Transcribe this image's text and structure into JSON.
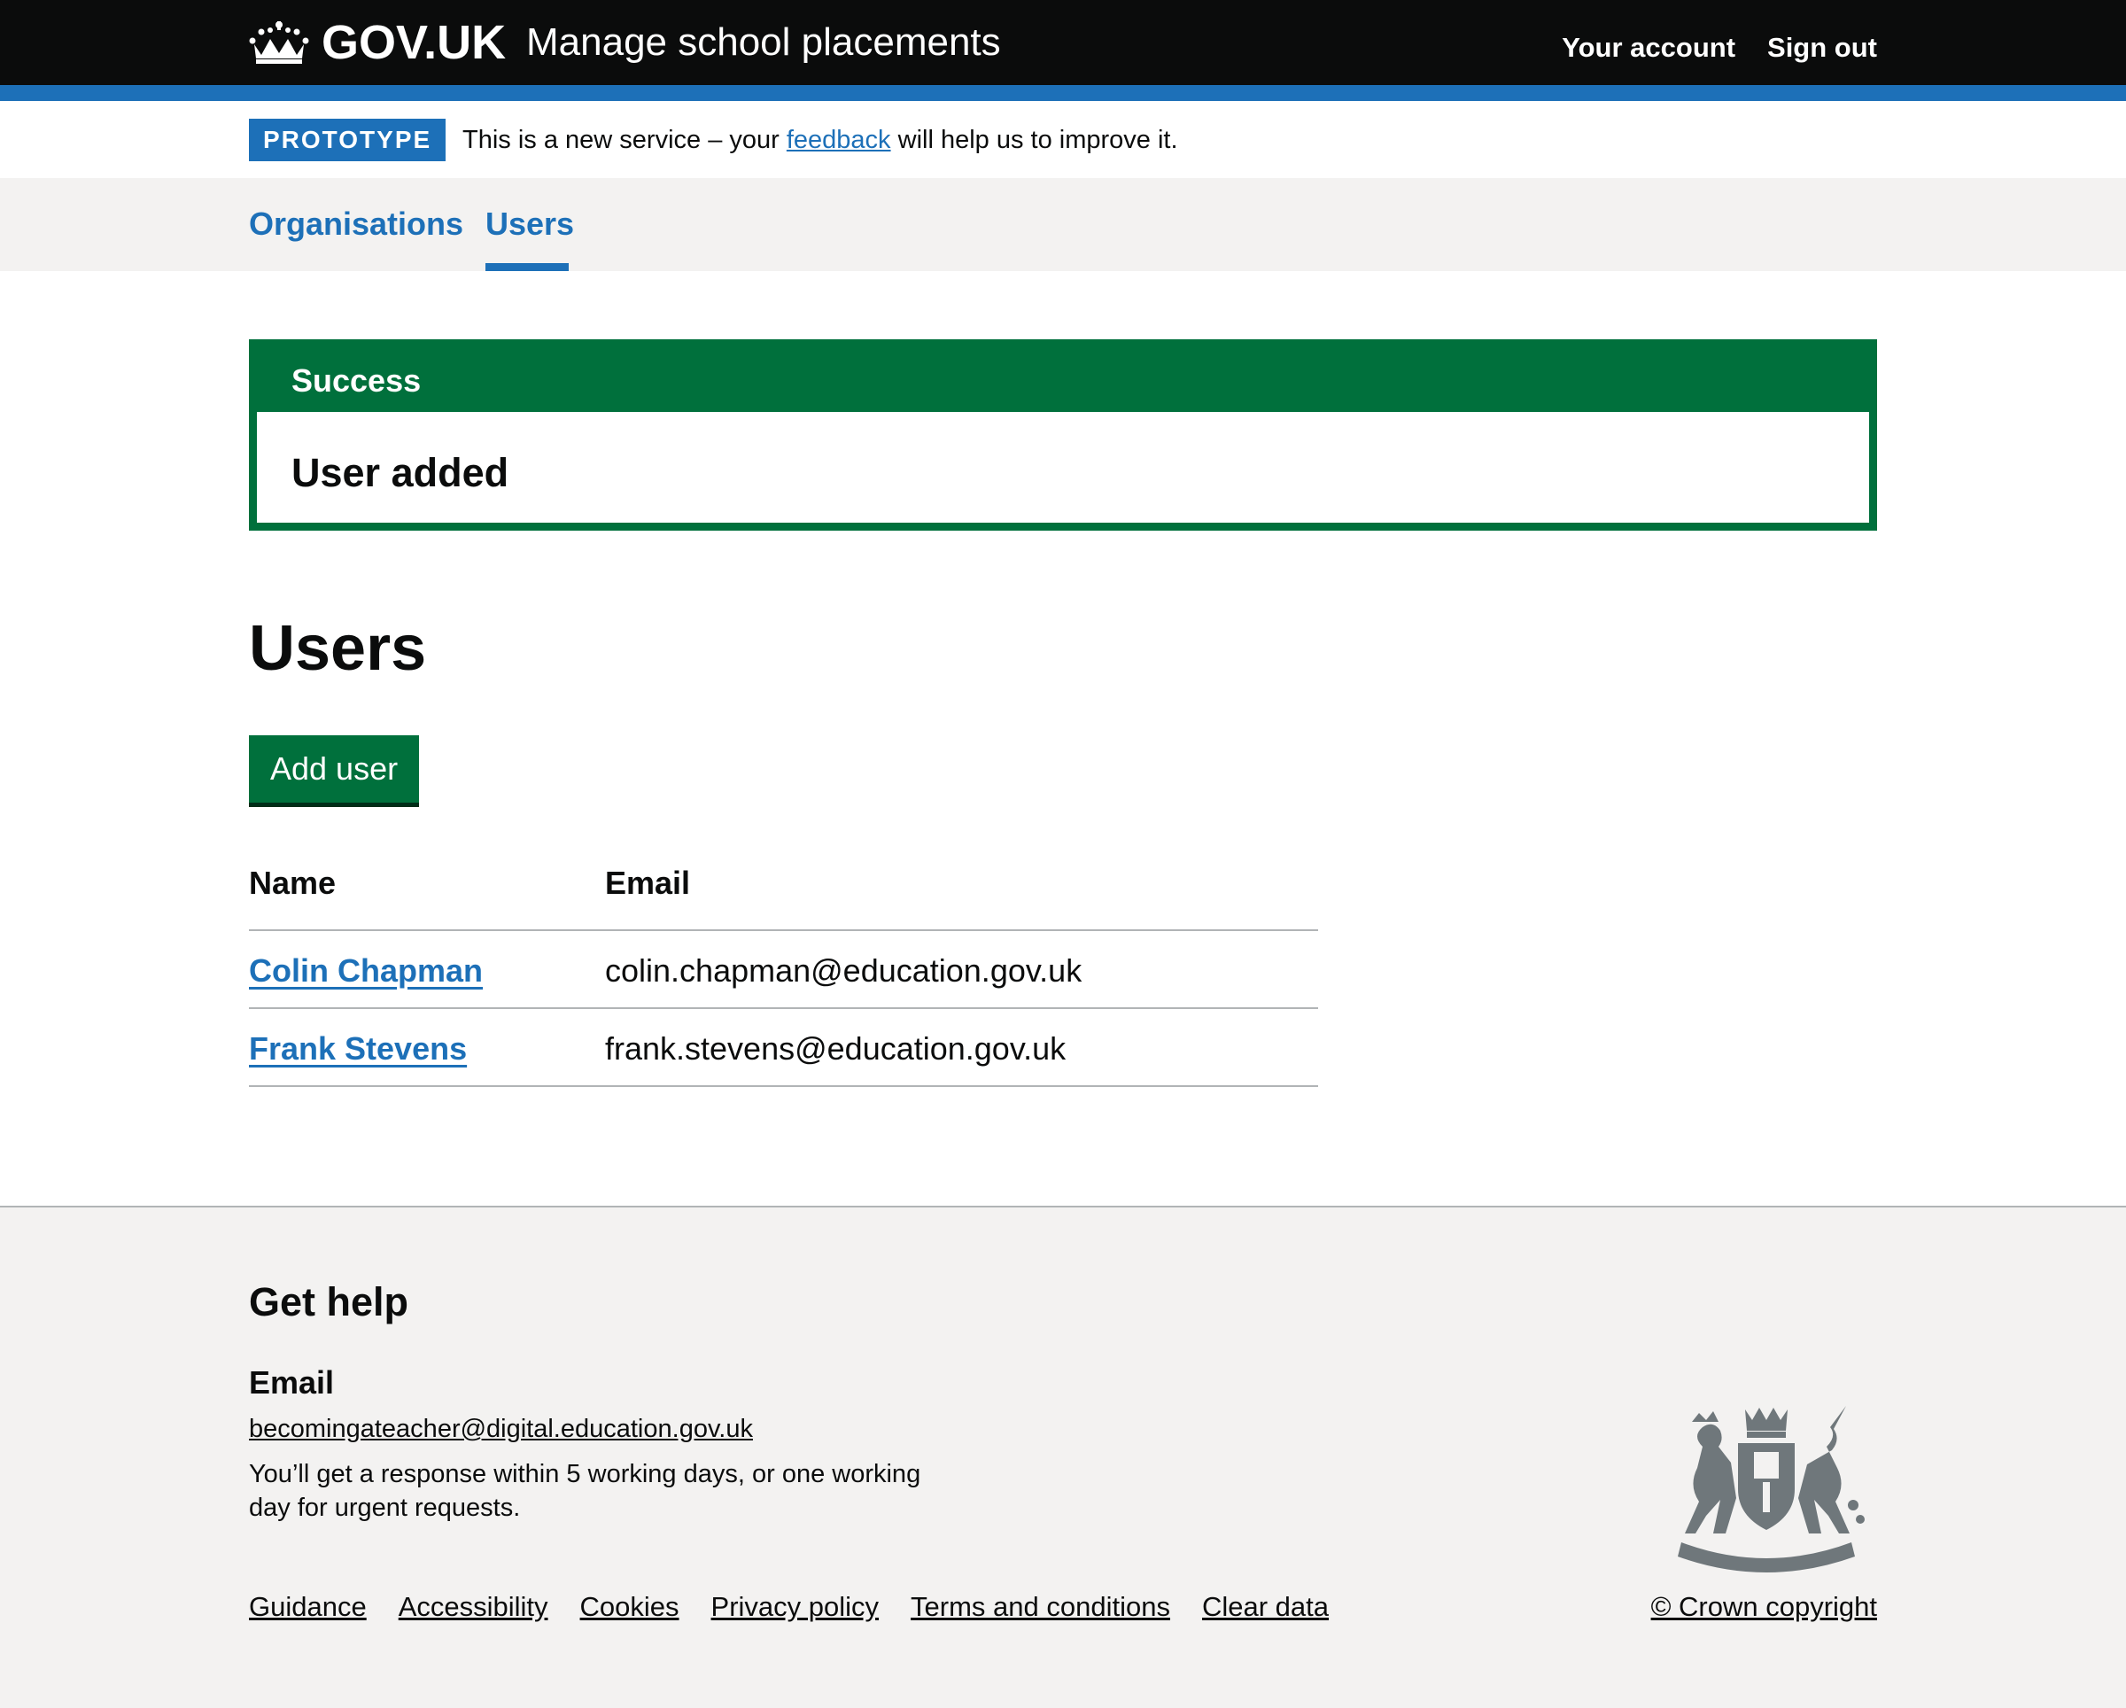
{
  "header": {
    "logo_text": "GOV.UK",
    "service_name": "Manage school placements",
    "nav": [
      "Your account",
      "Sign out"
    ]
  },
  "phase_banner": {
    "tag": "PROTOTYPE",
    "text_before": "This is a new service – your ",
    "link": "feedback",
    "text_after": " will help us to improve it."
  },
  "service_nav": {
    "items": [
      "Organisations",
      "Users"
    ],
    "active": "Users"
  },
  "notification": {
    "title": "Success",
    "message": "User added"
  },
  "page": {
    "title": "Users",
    "add_button": "Add user"
  },
  "table": {
    "headers": [
      "Name",
      "Email"
    ],
    "rows": [
      {
        "name": "Colin Chapman",
        "email": "colin.chapman@education.gov.uk"
      },
      {
        "name": "Frank Stevens",
        "email": "frank.stevens@education.gov.uk"
      }
    ]
  },
  "footer": {
    "heading": "Get help",
    "subheading": "Email",
    "email": "becomingateacher@digital.education.gov.uk",
    "response": "You’ll get a response within 5 working days, or one working day for urgent requests.",
    "links": [
      "Guidance",
      "Accessibility",
      "Cookies",
      "Privacy policy",
      "Terms and conditions",
      "Clear data"
    ],
    "copyright": "© Crown copyright"
  },
  "colors": {
    "header_bg": "#0b0c0c",
    "brand_blue": "#1d70b8",
    "success_green": "#00703c",
    "light_grey": "#f3f2f1",
    "crest_grey": "#6f777b"
  },
  "icons": {
    "logo": "crown-icon",
    "footer_crest": "royal-coat-of-arms-icon"
  }
}
